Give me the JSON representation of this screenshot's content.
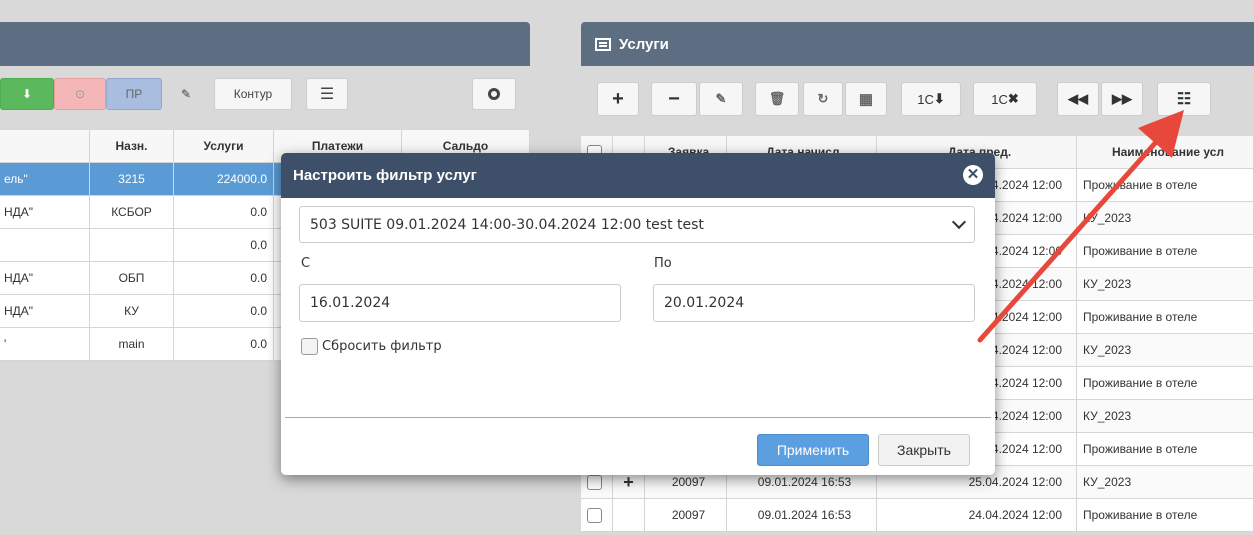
{
  "left": {
    "toolbar": {
      "pr_label": "ПР",
      "kontur_label": "Контур"
    },
    "columns": [
      "Назн.",
      "Услуги",
      "Платежи",
      "Сальдо"
    ],
    "rows": [
      {
        "name": "ель\"",
        "nazn": "3215",
        "uslugi": "224000.0",
        "selected": true
      },
      {
        "name": "НДА\"",
        "nazn": "КСБОР",
        "uslugi": "0.0"
      },
      {
        "name": "",
        "nazn": "",
        "uslugi": "0.0"
      },
      {
        "name": "НДА\"",
        "nazn": "ОБП",
        "uslugi": "0.0"
      },
      {
        "name": "НДА\"",
        "nazn": "КУ",
        "uslugi": "0.0"
      },
      {
        "name": "'",
        "nazn": "main",
        "uslugi": "0.0"
      }
    ]
  },
  "right": {
    "title": "Услуги",
    "toolbar": {
      "add": "+",
      "remove": "−",
      "import_1c": "1C",
      "delete_1c": "1C"
    },
    "columns": [
      "Заявка",
      "Дата начисл.",
      "Дата пред.",
      "Наименование усл"
    ],
    "rows": [
      {
        "zayavka": "",
        "date1": "",
        "date2": "24.2024 12:00",
        "name": "Проживание в отеле"
      },
      {
        "zayavka": "",
        "date1": "",
        "date2": "24.2024 12:00",
        "name": "КУ_2023"
      },
      {
        "zayavka": "",
        "date1": "",
        "date2": "24.2024 12:00",
        "name": "Проживание в отеле"
      },
      {
        "zayavka": "",
        "date1": "",
        "date2": "24.2024 12:00",
        "name": "КУ_2023"
      },
      {
        "zayavka": "",
        "date1": "",
        "date2": "24.2024 12:00",
        "name": "Проживание в отеле"
      },
      {
        "zayavka": "",
        "date1": "",
        "date2": "24.2024 12:00",
        "name": "КУ_2023"
      },
      {
        "zayavka": "",
        "date1": "",
        "date2": "24.2024 12:00",
        "name": "Проживание в отеле"
      },
      {
        "zayavka": "",
        "date1": "",
        "date2": "24.2024 12:00",
        "name": "КУ_2023"
      },
      {
        "zayavka": "",
        "date1": "",
        "date2": "24.2024 12:00",
        "name": "Проживание в отеле"
      },
      {
        "zayavka": "20097",
        "date1": "09.01.2024 16:53",
        "date2": "25.04.2024 12:00",
        "name": "КУ_2023"
      },
      {
        "zayavka": "20097",
        "date1": "09.01.2024 16:53",
        "date2": "24.04.2024 12:00",
        "name": "Проживание в отеле"
      }
    ]
  },
  "modal": {
    "title": "Настроить фильтр услуг",
    "booking_selected": "503 SUITE 09.01.2024 14:00-30.04.2024 12:00 test test",
    "from_label": "С",
    "to_label": "По",
    "from_value": "16.01.2024",
    "to_value": "20.01.2024",
    "reset_label": "Сбросить фильтр",
    "apply_label": "Применить",
    "close_label": "Закрыть"
  },
  "colors": {
    "panel_header": "#5d6d82",
    "modal_header": "#3e5069",
    "selected_row": "#5b9bd5",
    "apply_button": "#5c9fe0",
    "arrow": "#e8473b"
  }
}
